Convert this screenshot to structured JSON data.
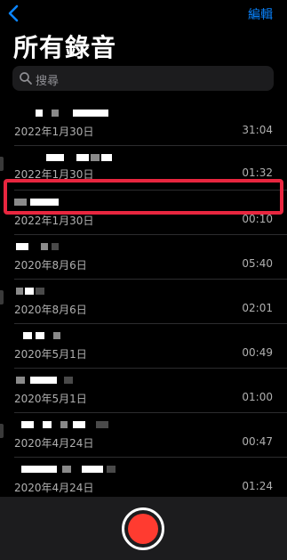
{
  "header": {
    "back_icon": "chevron-left-icon",
    "edit_label": "編輯",
    "title": "所有錄音",
    "accent_color": "#0a84ff"
  },
  "search": {
    "placeholder": "搜尋",
    "icon": "search-icon"
  },
  "recordings": [
    {
      "date": "2022年1月30日",
      "duration": "31:04"
    },
    {
      "date": "2022年1月30日",
      "duration": "01:32"
    },
    {
      "date": "2022年1月30日",
      "duration": "00:10"
    },
    {
      "date": "2020年8月6日",
      "duration": "05:40"
    },
    {
      "date": "2020年8月6日",
      "duration": "02:01"
    },
    {
      "date": "2020年5月1日",
      "duration": "00:49"
    },
    {
      "date": "2020年5月1日",
      "duration": "01:00"
    },
    {
      "date": "2020年4月24日",
      "duration": "00:47"
    },
    {
      "date": "2020年4月24日",
      "duration": "01:24"
    }
  ],
  "highlight_color": "#e8263f",
  "record_button": {
    "icon": "record-icon",
    "color": "#ff3b30"
  }
}
